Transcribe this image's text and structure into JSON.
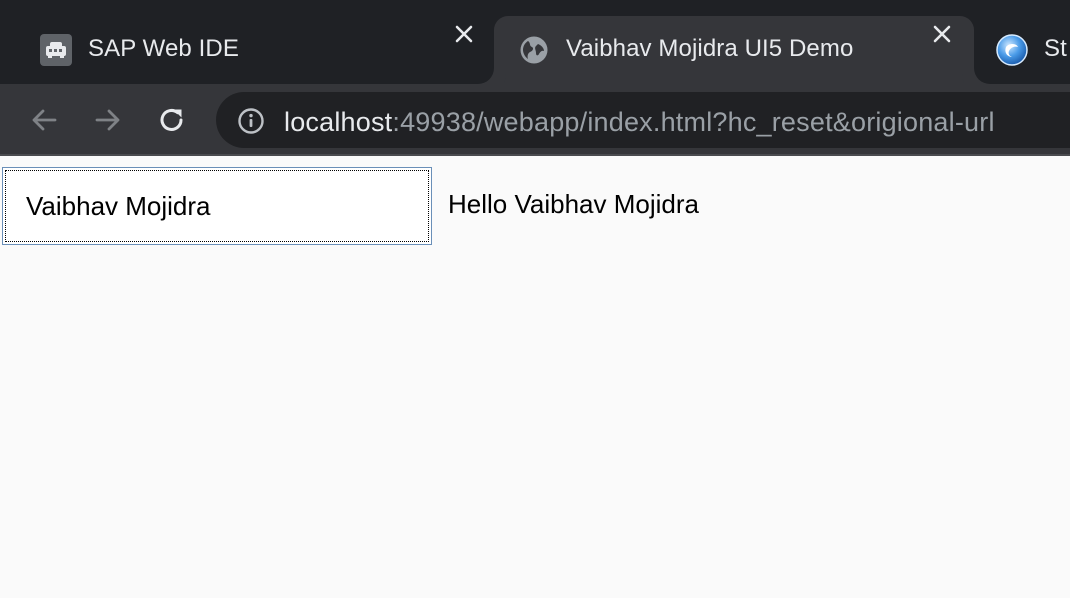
{
  "browser": {
    "tabs": [
      {
        "title": "SAP Web IDE",
        "icon": "sap-icon",
        "active": false,
        "close": "✕"
      },
      {
        "title": "Vaibhav Mojidra UI5 Demo",
        "icon": "globe-icon",
        "active": true,
        "close": "✕"
      },
      {
        "title": "St",
        "icon": "store-icon",
        "active": false
      }
    ],
    "toolbar": {
      "back_icon": "arrow-left-icon",
      "forward_icon": "arrow-right-icon",
      "reload_icon": "reload-icon",
      "site_info_icon": "info-icon"
    },
    "address": {
      "host": "localhost",
      "rest": ":49938/webapp/index.html?hc_reset&origional-url"
    },
    "colors": {
      "tabstrip": "#1f2125",
      "active_tab": "#35363a",
      "omnibox": "#202124"
    }
  },
  "app": {
    "name_input": {
      "value": "Vaibhav Mojidra"
    },
    "greeting": "Hello Vaibhav Mojidra"
  }
}
